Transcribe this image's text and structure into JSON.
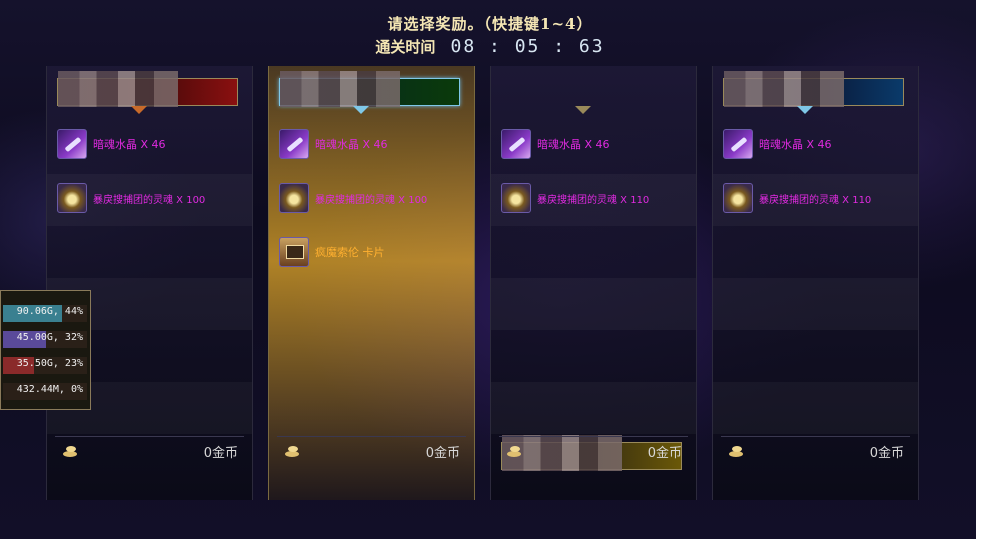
{
  "header": {
    "prompt": "请选择奖励。（快捷键1~4）",
    "time_label": "通关时间",
    "time_value": "08 : 05 : 63"
  },
  "panels": [
    {
      "banner_color": "#8a1010",
      "rewards": [
        {
          "icon": "crystal-icon",
          "text": "暗魂水晶 X 46"
        },
        {
          "icon": "soul-icon",
          "text": "暴戾搜捕团的灵魂 X 100"
        }
      ],
      "gold": "0金币"
    },
    {
      "banner_color": "#0a3a0a",
      "selected": true,
      "rewards": [
        {
          "icon": "crystal-icon",
          "text": "暗魂水晶 X 46"
        },
        {
          "icon": "soul-icon",
          "text": "暴戾搜捕团的灵魂 X 100"
        },
        {
          "icon": "card-icon",
          "text": "疯魔索伦 卡片"
        }
      ],
      "gold": "0金币"
    },
    {
      "banner_color": "#6a5808",
      "rewards": [
        {
          "icon": "crystal-icon",
          "text": "暗魂水晶 X 46"
        },
        {
          "icon": "soul-icon",
          "text": "暴戾搜捕团的灵魂 X 110"
        }
      ],
      "gold": "0金币"
    },
    {
      "banner_color": "#0a3a6a",
      "rewards": [
        {
          "icon": "crystal-icon",
          "text": "暗魂水晶 X 46"
        },
        {
          "icon": "soul-icon",
          "text": "暴戾搜捕团的灵魂 X 110"
        }
      ],
      "gold": "0金币"
    }
  ],
  "ratios": [
    {
      "text": "90.06G, 44%",
      "percent": 44,
      "color": "#3a8090"
    },
    {
      "text": "45.00G, 32%",
      "percent": 32,
      "color": "#5a4a9a"
    },
    {
      "text": "35.50G, 23%",
      "percent": 23,
      "color": "#8a2a2a"
    },
    {
      "text": "432.44M, 0%",
      "percent": 0,
      "color": "#8a2a2a"
    }
  ],
  "colors": {
    "item_text": "#e02ae0",
    "card_text": "#ffb030",
    "header_text": "#f5e7b5",
    "selected_glow": "#e6aa28"
  }
}
